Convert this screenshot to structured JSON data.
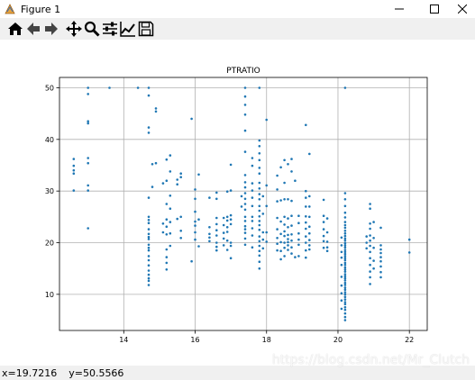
{
  "window": {
    "title": "Figure 1",
    "minimize_icon": "minimize-icon",
    "maximize_icon": "maximize-icon",
    "close_icon": "close-icon"
  },
  "toolbar": {
    "buttons": [
      {
        "name": "home-button",
        "icon": "home-icon"
      },
      {
        "name": "back-button",
        "icon": "back-arrow-icon"
      },
      {
        "name": "forward-button",
        "icon": "forward-arrow-icon"
      },
      {
        "name": "pan-button",
        "icon": "move-icon"
      },
      {
        "name": "zoom-button",
        "icon": "magnifier-icon"
      },
      {
        "name": "configure-subplots-button",
        "icon": "sliders-icon"
      },
      {
        "name": "edit-axes-button",
        "icon": "line-chart-icon"
      },
      {
        "name": "save-button",
        "icon": "floppy-disk-icon"
      }
    ]
  },
  "status": {
    "x": "x=19.7216",
    "y": "y=50.5566"
  },
  "watermark": "https://blog.csdn.net/Mr_Clutch",
  "colors": {
    "marker": "#1f77b4",
    "grid": "#b0b0b0"
  },
  "chart_data": {
    "type": "scatter",
    "title": "PTRATIO",
    "xlabel": "",
    "ylabel": "",
    "xlim": [
      12.2,
      22.5
    ],
    "ylim": [
      3,
      52
    ],
    "xticks": [
      14,
      16,
      18,
      20,
      22
    ],
    "yticks": [
      10,
      20,
      30,
      40,
      50
    ],
    "grid": true,
    "points": [
      [
        12.6,
        30.1
      ],
      [
        12.6,
        34.0
      ],
      [
        12.6,
        34.9
      ],
      [
        12.6,
        33.4
      ],
      [
        12.6,
        36.2
      ],
      [
        13.0,
        50.0
      ],
      [
        13.0,
        48.8
      ],
      [
        13.0,
        43.5
      ],
      [
        13.0,
        43.1
      ],
      [
        13.0,
        36.4
      ],
      [
        13.0,
        35.4
      ],
      [
        13.0,
        31.1
      ],
      [
        13.0,
        30.1
      ],
      [
        13.0,
        22.8
      ],
      [
        13.6,
        50.0
      ],
      [
        14.4,
        50.0
      ],
      [
        14.7,
        50.0
      ],
      [
        14.7,
        48.5
      ],
      [
        14.7,
        42.3
      ],
      [
        14.7,
        41.3
      ],
      [
        14.7,
        28.7
      ],
      [
        14.7,
        25.0
      ],
      [
        14.7,
        24.4
      ],
      [
        14.7,
        23.8
      ],
      [
        14.7,
        22.6
      ],
      [
        14.7,
        21.7
      ],
      [
        14.7,
        20.7
      ],
      [
        14.7,
        19.6
      ],
      [
        14.7,
        18.5
      ],
      [
        14.7,
        17.4
      ],
      [
        14.7,
        16.6
      ],
      [
        14.7,
        15.6
      ],
      [
        14.7,
        14.6
      ],
      [
        14.7,
        13.8
      ],
      [
        14.7,
        13.1
      ],
      [
        14.7,
        12.6
      ],
      [
        14.7,
        11.8
      ],
      [
        14.7,
        19.0
      ],
      [
        14.7,
        21.1
      ],
      [
        14.8,
        35.2
      ],
      [
        14.8,
        30.8
      ],
      [
        14.9,
        46.0
      ],
      [
        14.9,
        45.4
      ],
      [
        14.9,
        35.4
      ],
      [
        15.1,
        31.5
      ],
      [
        15.1,
        23.7
      ],
      [
        15.1,
        22.0
      ],
      [
        15.2,
        36.1
      ],
      [
        15.2,
        32.0
      ],
      [
        15.2,
        27.5
      ],
      [
        15.2,
        24.5
      ],
      [
        15.2,
        23.1
      ],
      [
        15.2,
        21.6
      ],
      [
        15.2,
        18.7
      ],
      [
        15.2,
        17.2
      ],
      [
        15.2,
        16.1
      ],
      [
        15.2,
        14.8
      ],
      [
        15.3,
        36.9
      ],
      [
        15.3,
        33.8
      ],
      [
        15.3,
        29.1
      ],
      [
        15.3,
        26.6
      ],
      [
        15.3,
        24.0
      ],
      [
        15.3,
        21.8
      ],
      [
        15.3,
        19.4
      ],
      [
        15.5,
        32.2
      ],
      [
        15.5,
        31.3
      ],
      [
        15.5,
        24.6
      ],
      [
        15.6,
        33.4
      ],
      [
        15.6,
        32.7
      ],
      [
        15.6,
        25.0
      ],
      [
        15.6,
        22.3
      ],
      [
        15.6,
        20.9
      ],
      [
        15.9,
        44.0
      ],
      [
        15.9,
        16.4
      ],
      [
        16.0,
        30.3
      ],
      [
        16.0,
        26.0
      ],
      [
        16.0,
        24.1
      ],
      [
        16.0,
        23.3
      ],
      [
        16.0,
        22.0
      ],
      [
        16.0,
        20.6
      ],
      [
        16.0,
        28.5
      ],
      [
        16.1,
        33.2
      ],
      [
        16.1,
        24.5
      ],
      [
        16.1,
        19.3
      ],
      [
        16.4,
        28.7
      ],
      [
        16.4,
        23.0
      ],
      [
        16.4,
        21.7
      ],
      [
        16.4,
        21.0
      ],
      [
        16.4,
        20.3
      ],
      [
        16.6,
        29.7
      ],
      [
        16.6,
        28.5
      ],
      [
        16.6,
        24.8
      ],
      [
        16.6,
        23.6
      ],
      [
        16.6,
        22.4
      ],
      [
        16.6,
        21.4
      ],
      [
        16.6,
        20.0
      ],
      [
        16.6,
        19.2
      ],
      [
        16.6,
        18.5
      ],
      [
        16.8,
        24.8
      ],
      [
        16.8,
        23.4
      ],
      [
        16.8,
        21.9
      ],
      [
        16.8,
        20.8
      ],
      [
        16.8,
        19.5
      ],
      [
        16.9,
        29.9
      ],
      [
        16.9,
        25.0
      ],
      [
        16.9,
        24.3
      ],
      [
        16.9,
        23.0
      ],
      [
        16.9,
        22.1
      ],
      [
        16.9,
        20.4
      ],
      [
        16.9,
        18.6
      ],
      [
        17.0,
        35.1
      ],
      [
        17.0,
        30.1
      ],
      [
        17.0,
        25.3
      ],
      [
        17.0,
        24.5
      ],
      [
        17.0,
        23.6
      ],
      [
        17.0,
        20.0
      ],
      [
        17.0,
        19.4
      ],
      [
        17.0,
        17.0
      ],
      [
        17.3,
        29.0
      ],
      [
        17.3,
        27.0
      ],
      [
        17.4,
        50.0
      ],
      [
        17.4,
        48.3
      ],
      [
        17.4,
        46.7
      ],
      [
        17.4,
        44.8
      ],
      [
        17.4,
        41.7
      ],
      [
        17.4,
        37.6
      ],
      [
        17.4,
        33.1
      ],
      [
        17.4,
        31.7
      ],
      [
        17.4,
        30.7
      ],
      [
        17.4,
        29.6
      ],
      [
        17.4,
        28.5
      ],
      [
        17.4,
        27.5
      ],
      [
        17.4,
        26.4
      ],
      [
        17.4,
        25.0
      ],
      [
        17.4,
        24.2
      ],
      [
        17.4,
        23.2
      ],
      [
        17.4,
        22.6
      ],
      [
        17.4,
        21.9
      ],
      [
        17.4,
        20.8
      ],
      [
        17.4,
        19.6
      ],
      [
        17.6,
        36.4
      ],
      [
        17.6,
        34.9
      ],
      [
        17.6,
        31.5
      ],
      [
        17.6,
        30.1
      ],
      [
        17.6,
        28.7
      ],
      [
        17.6,
        27.1
      ],
      [
        17.6,
        25.0
      ],
      [
        17.6,
        24.2
      ],
      [
        17.6,
        22.8
      ],
      [
        17.6,
        21.4
      ],
      [
        17.6,
        19.1
      ],
      [
        17.8,
        50.0
      ],
      [
        17.8,
        39.8
      ],
      [
        17.8,
        38.7
      ],
      [
        17.8,
        37.3
      ],
      [
        17.8,
        36.0
      ],
      [
        17.8,
        34.5
      ],
      [
        17.8,
        33.4
      ],
      [
        17.8,
        31.6
      ],
      [
        17.8,
        30.5
      ],
      [
        17.8,
        29.4
      ],
      [
        17.8,
        28.4
      ],
      [
        17.8,
        27.1
      ],
      [
        17.8,
        26.2
      ],
      [
        17.8,
        25.1
      ],
      [
        17.8,
        24.2
      ],
      [
        17.8,
        23.4
      ],
      [
        17.8,
        22.5
      ],
      [
        17.8,
        21.2
      ],
      [
        17.8,
        20.3
      ],
      [
        17.8,
        19.4
      ],
      [
        17.8,
        18.4
      ],
      [
        17.8,
        17.5
      ],
      [
        17.8,
        16.3
      ],
      [
        17.8,
        15.0
      ],
      [
        17.9,
        29.0
      ],
      [
        17.9,
        25.6
      ],
      [
        17.9,
        22.0
      ],
      [
        17.9,
        20.6
      ],
      [
        17.9,
        18.9
      ],
      [
        18.0,
        43.8
      ],
      [
        18.0,
        31.1
      ],
      [
        18.0,
        27.1
      ],
      [
        18.0,
        22.0
      ],
      [
        18.0,
        20.2
      ],
      [
        18.3,
        33.0
      ],
      [
        18.3,
        30.3
      ],
      [
        18.3,
        28.0
      ],
      [
        18.3,
        24.8
      ],
      [
        18.3,
        22.6
      ],
      [
        18.3,
        20.9
      ],
      [
        18.3,
        19.8
      ],
      [
        18.3,
        18.5
      ],
      [
        18.4,
        34.6
      ],
      [
        18.4,
        28.2
      ],
      [
        18.4,
        24.1
      ],
      [
        18.4,
        21.7
      ],
      [
        18.4,
        20.1
      ],
      [
        18.4,
        18.4
      ],
      [
        18.4,
        16.8
      ],
      [
        18.5,
        36.0
      ],
      [
        18.5,
        31.6
      ],
      [
        18.5,
        28.4
      ],
      [
        18.5,
        25.0
      ],
      [
        18.5,
        23.5
      ],
      [
        18.5,
        22.2
      ],
      [
        18.5,
        21.3
      ],
      [
        18.5,
        20.0
      ],
      [
        18.5,
        19.0
      ],
      [
        18.5,
        17.4
      ],
      [
        18.6,
        35.2
      ],
      [
        18.6,
        28.4
      ],
      [
        18.6,
        24.7
      ],
      [
        18.6,
        23.0
      ],
      [
        18.6,
        21.5
      ],
      [
        18.6,
        20.7
      ],
      [
        18.6,
        20.1
      ],
      [
        18.6,
        19.5
      ],
      [
        18.6,
        18.6
      ],
      [
        18.7,
        36.2
      ],
      [
        18.7,
        33.8
      ],
      [
        18.7,
        28.1
      ],
      [
        18.7,
        25.2
      ],
      [
        18.7,
        23.3
      ],
      [
        18.7,
        21.6
      ],
      [
        18.7,
        20.4
      ],
      [
        18.7,
        19.1
      ],
      [
        18.7,
        17.9
      ],
      [
        18.8,
        32.0
      ],
      [
        18.8,
        17.2
      ],
      [
        18.9,
        25.2
      ],
      [
        18.9,
        23.8
      ],
      [
        18.9,
        21.8
      ],
      [
        18.9,
        20.6
      ],
      [
        18.9,
        19.6
      ],
      [
        18.9,
        17.4
      ],
      [
        19.1,
        42.8
      ],
      [
        19.1,
        30.0
      ],
      [
        19.1,
        28.7
      ],
      [
        19.1,
        27.0
      ],
      [
        19.1,
        25.1
      ],
      [
        19.1,
        23.9
      ],
      [
        19.1,
        22.7
      ],
      [
        19.1,
        21.2
      ],
      [
        19.1,
        20.0
      ],
      [
        19.1,
        18.5
      ],
      [
        19.1,
        17.1
      ],
      [
        19.2,
        37.2
      ],
      [
        19.2,
        29.0
      ],
      [
        19.2,
        27.0
      ],
      [
        19.2,
        25.0
      ],
      [
        19.2,
        23.1
      ],
      [
        19.2,
        21.8
      ],
      [
        19.2,
        20.5
      ],
      [
        19.2,
        19.5
      ],
      [
        19.2,
        18.7
      ],
      [
        19.6,
        28.3
      ],
      [
        19.6,
        25.2
      ],
      [
        19.6,
        24.0
      ],
      [
        19.6,
        22.6
      ],
      [
        19.6,
        21.3
      ],
      [
        19.6,
        20.3
      ],
      [
        19.6,
        19.0
      ],
      [
        19.7,
        24.7
      ],
      [
        19.7,
        22.0
      ],
      [
        19.7,
        20.2
      ],
      [
        19.7,
        19.1
      ],
      [
        19.7,
        18.4
      ],
      [
        20.1,
        21.0
      ],
      [
        20.1,
        19.5
      ],
      [
        20.1,
        18.2
      ],
      [
        20.1,
        17.1
      ],
      [
        20.1,
        15.7
      ],
      [
        20.2,
        50.0
      ],
      [
        20.2,
        29.6
      ],
      [
        20.2,
        28.4
      ],
      [
        20.2,
        27.1
      ],
      [
        20.2,
        25.8
      ],
      [
        20.2,
        24.9
      ],
      [
        20.2,
        24.0
      ],
      [
        20.2,
        23.4
      ],
      [
        20.2,
        22.9
      ],
      [
        20.2,
        22.3
      ],
      [
        20.2,
        21.8
      ],
      [
        20.2,
        21.3
      ],
      [
        20.2,
        20.8
      ],
      [
        20.2,
        20.4
      ],
      [
        20.2,
        19.9
      ],
      [
        20.2,
        19.5
      ],
      [
        20.2,
        19.1
      ],
      [
        20.2,
        18.6
      ],
      [
        20.2,
        18.2
      ],
      [
        20.2,
        17.8
      ],
      [
        20.2,
        17.4
      ],
      [
        20.2,
        17.0
      ],
      [
        20.2,
        16.6
      ],
      [
        20.2,
        16.1
      ],
      [
        20.2,
        15.7
      ],
      [
        20.2,
        15.2
      ],
      [
        20.2,
        14.8
      ],
      [
        20.2,
        14.4
      ],
      [
        20.2,
        13.9
      ],
      [
        20.2,
        13.5
      ],
      [
        20.2,
        13.1
      ],
      [
        20.2,
        12.7
      ],
      [
        20.2,
        12.2
      ],
      [
        20.2,
        11.8
      ],
      [
        20.2,
        11.3
      ],
      [
        20.2,
        10.9
      ],
      [
        20.2,
        10.4
      ],
      [
        20.2,
        10.0
      ],
      [
        20.2,
        9.5
      ],
      [
        20.2,
        9.0
      ],
      [
        20.2,
        8.5
      ],
      [
        20.2,
        8.1
      ],
      [
        20.2,
        7.5
      ],
      [
        20.2,
        7.0
      ],
      [
        20.2,
        6.3
      ],
      [
        20.2,
        5.6
      ],
      [
        20.2,
        5.0
      ],
      [
        20.1,
        8.8
      ],
      [
        20.1,
        7.2
      ],
      [
        20.1,
        11.7
      ],
      [
        20.1,
        13.4
      ],
      [
        20.1,
        10.2
      ],
      [
        20.9,
        27.5
      ],
      [
        20.9,
        26.6
      ],
      [
        20.9,
        23.7
      ],
      [
        20.9,
        22.7
      ],
      [
        20.9,
        21.4
      ],
      [
        20.9,
        20.4
      ],
      [
        20.9,
        19.4
      ],
      [
        20.9,
        18.2
      ],
      [
        20.9,
        17.0
      ],
      [
        20.9,
        15.7
      ],
      [
        20.9,
        14.4
      ],
      [
        20.9,
        13.3
      ],
      [
        20.9,
        12.0
      ],
      [
        20.8,
        21.2
      ],
      [
        20.8,
        20.0
      ],
      [
        20.8,
        18.9
      ],
      [
        21.0,
        24.0
      ],
      [
        21.0,
        20.9
      ],
      [
        21.0,
        19.0
      ],
      [
        21.0,
        16.5
      ],
      [
        21.0,
        15.0
      ],
      [
        21.2,
        22.9
      ],
      [
        21.2,
        19.5
      ],
      [
        21.2,
        18.7
      ],
      [
        21.2,
        18.0
      ],
      [
        21.2,
        17.2
      ],
      [
        21.2,
        16.4
      ],
      [
        21.2,
        15.4
      ],
      [
        21.2,
        14.3
      ],
      [
        21.2,
        13.3
      ],
      [
        22.0,
        20.6
      ],
      [
        22.0,
        18.1
      ]
    ]
  }
}
